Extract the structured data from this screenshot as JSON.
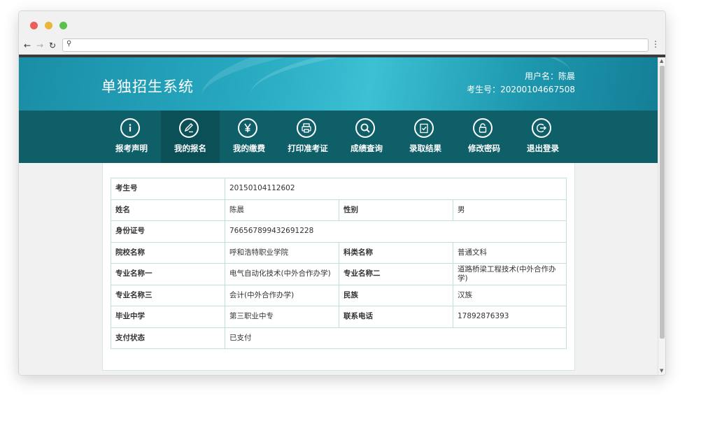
{
  "header": {
    "title": "单独招生系统",
    "username_label": "用户名：陈晨",
    "exam_no_label": "考生号：20200104667508"
  },
  "menu": [
    {
      "label": "报考声明",
      "icon": "info-icon"
    },
    {
      "label": "我的报名",
      "icon": "edit-icon"
    },
    {
      "label": "我的缴费",
      "icon": "yen-icon"
    },
    {
      "label": "打印准考证",
      "icon": "printer-icon"
    },
    {
      "label": "成绩查询",
      "icon": "search-icon"
    },
    {
      "label": "录取结果",
      "icon": "clipboard-check-icon"
    },
    {
      "label": "修改密码",
      "icon": "lock-icon"
    },
    {
      "label": "退出登录",
      "icon": "logout-icon"
    }
  ],
  "active_menu": "我的报名",
  "info": {
    "exam_no": {
      "label": "考生号",
      "value": "20150104112602"
    },
    "name": {
      "label": "姓名",
      "value": "陈晨"
    },
    "gender": {
      "label": "性别",
      "value": "男"
    },
    "id_no": {
      "label": "身份证号",
      "value": "766567899432691228"
    },
    "school": {
      "label": "院校名称",
      "value": "呼和浩特职业学院"
    },
    "category": {
      "label": "科类名称",
      "value": "普通文科"
    },
    "major1": {
      "label": "专业名称一",
      "value": "电气自动化技术(中外合作办学)"
    },
    "major2": {
      "label": "专业名称二",
      "value": "道路桥梁工程技术(中外合作办学)"
    },
    "major3": {
      "label": "专业名称三",
      "value": "会计(中外合作办学)"
    },
    "ethnicity": {
      "label": "民族",
      "value": "汉族"
    },
    "high_school": {
      "label": "毕业中学",
      "value": "第三职业中专"
    },
    "phone": {
      "label": "联系电话",
      "value": "17892876393"
    },
    "payment_status": {
      "label": "支付状态",
      "value": "已支付"
    }
  }
}
